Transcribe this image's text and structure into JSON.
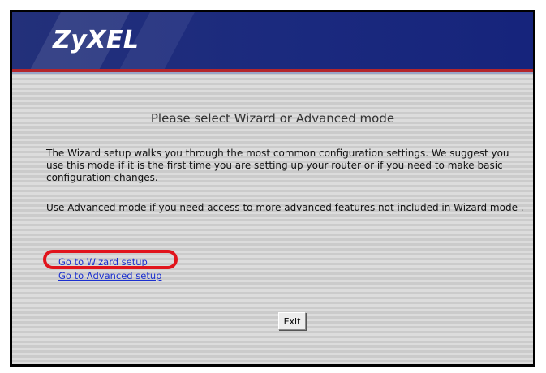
{
  "header": {
    "logo_text": "ZyXEL",
    "brand_bar_color": "#1b2a7e",
    "accent_rule_color": "#b3262c"
  },
  "main": {
    "title": "Please select Wizard or Advanced mode",
    "paragraph_wizard": "The Wizard setup walks you through the most common configuration settings. We suggest you use this mode if it is the first time you are setting up your router or if you need to make basic configuration changes.",
    "paragraph_advanced": "Use Advanced mode if you need access to more advanced features not included in Wizard mode .",
    "links": [
      {
        "label": "Go to Wizard setup",
        "highlighted": true
      },
      {
        "label": "Go to Advanced setup",
        "highlighted": false
      }
    ],
    "highlight_color": "#e1141c",
    "link_color": "#1a2fcf",
    "exit_label": "Exit"
  }
}
